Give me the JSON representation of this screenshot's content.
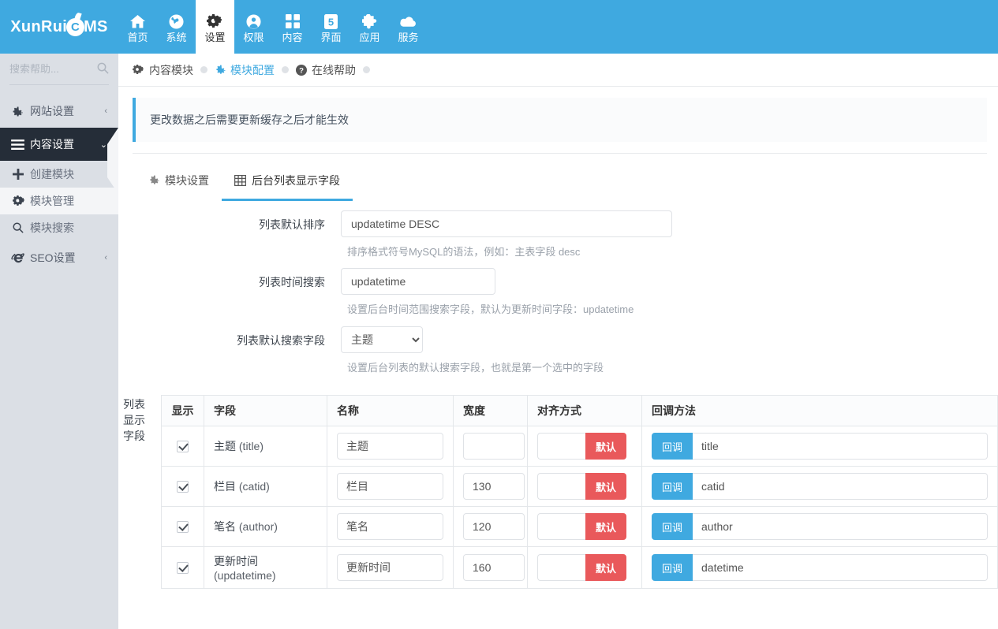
{
  "brand": {
    "text_before": "XunRui",
    "flame_letter": "C",
    "text_after": "MS"
  },
  "topnav": {
    "items": [
      {
        "label": "首页",
        "icon": "home-icon",
        "active": false
      },
      {
        "label": "系统",
        "icon": "globe-icon",
        "active": false
      },
      {
        "label": "设置",
        "icon": "gears-icon",
        "active": true
      },
      {
        "label": "权限",
        "icon": "user-circle-icon",
        "active": false
      },
      {
        "label": "内容",
        "icon": "grid-icon",
        "active": false
      },
      {
        "label": "界面",
        "icon": "html5-icon",
        "active": false
      },
      {
        "label": "应用",
        "icon": "puzzle-icon",
        "active": false
      },
      {
        "label": "服务",
        "icon": "cloud-icon",
        "active": false
      }
    ]
  },
  "sidebar": {
    "search_placeholder": "搜索帮助...",
    "search_value": "",
    "items": [
      {
        "label": "网站设置",
        "icon": "gear-icon",
        "caret": "‹",
        "active": false
      },
      {
        "label": "内容设置",
        "icon": "bars-icon",
        "caret": "⌄",
        "active": true
      }
    ],
    "subitems": [
      {
        "label": "创建模块",
        "icon": "plus-icon",
        "selected": false
      },
      {
        "label": "模块管理",
        "icon": "gears-icon",
        "selected": true
      },
      {
        "label": "模块搜索",
        "icon": "search-icon",
        "selected": false
      }
    ],
    "items_after": [
      {
        "label": "SEO设置",
        "icon": "ie-icon",
        "caret": "‹",
        "active": false
      }
    ]
  },
  "breadcrumb": [
    {
      "label": "内容模块",
      "icon": "gears-icon",
      "current": false
    },
    {
      "label": "模块配置",
      "icon": "gear-icon",
      "current": true
    },
    {
      "label": "在线帮助",
      "icon": "question-circle-icon",
      "current": false
    }
  ],
  "alert": {
    "text": "更改数据之后需要更新缓存之后才能生效"
  },
  "tabs": [
    {
      "label": "模块设置",
      "icon": "gear-icon",
      "active": false
    },
    {
      "label": "后台列表显示字段",
      "icon": "table-icon",
      "active": true
    }
  ],
  "form": {
    "sort": {
      "label": "列表默认排序",
      "value": "updatetime DESC",
      "placeholder": "",
      "help": "排序格式符号MySQL的语法，例如：主表字段 desc"
    },
    "time_search": {
      "label": "列表时间搜索",
      "value": "updatetime",
      "placeholder": "",
      "help": "设置后台时间范围搜索字段，默认为更新时间字段：updatetime"
    },
    "default_search_field": {
      "label": "列表默认搜索字段",
      "selected": "主题",
      "options": [
        "主题"
      ],
      "help": "设置后台列表的默认搜索字段，也就是第一个选中的字段"
    },
    "display_fields": {
      "label": "列表显示字段"
    }
  },
  "table": {
    "headers": [
      "显示",
      "字段",
      "名称",
      "宽度",
      "对齐方式",
      "回调方法"
    ],
    "rows": [
      {
        "checked": true,
        "field": "主题",
        "field_en": "(title)",
        "name": "主题",
        "width": "",
        "align_value": "",
        "align_button": "默认",
        "callback_button": "回调",
        "callback_value": "title"
      },
      {
        "checked": true,
        "field": "栏目",
        "field_en": "(catid)",
        "name": "栏目",
        "width": "130",
        "align_value": "",
        "align_button": "默认",
        "callback_button": "回调",
        "callback_value": "catid"
      },
      {
        "checked": true,
        "field": "笔名",
        "field_en": "(author)",
        "name": "笔名",
        "width": "120",
        "align_value": "",
        "align_button": "默认",
        "callback_button": "回调",
        "callback_value": "author"
      },
      {
        "checked": true,
        "field": "更新时间",
        "field_en": "(updatetime)",
        "name": "更新时间",
        "width": "160",
        "align_value": "",
        "align_button": "默认",
        "callback_button": "回调",
        "callback_value": "datetime"
      }
    ]
  },
  "colors": {
    "brand_blue": "#3fa9e0",
    "sidebar_bg": "#dbdfe5",
    "sidebar_active": "#252d38",
    "danger_red": "#e9595b"
  }
}
